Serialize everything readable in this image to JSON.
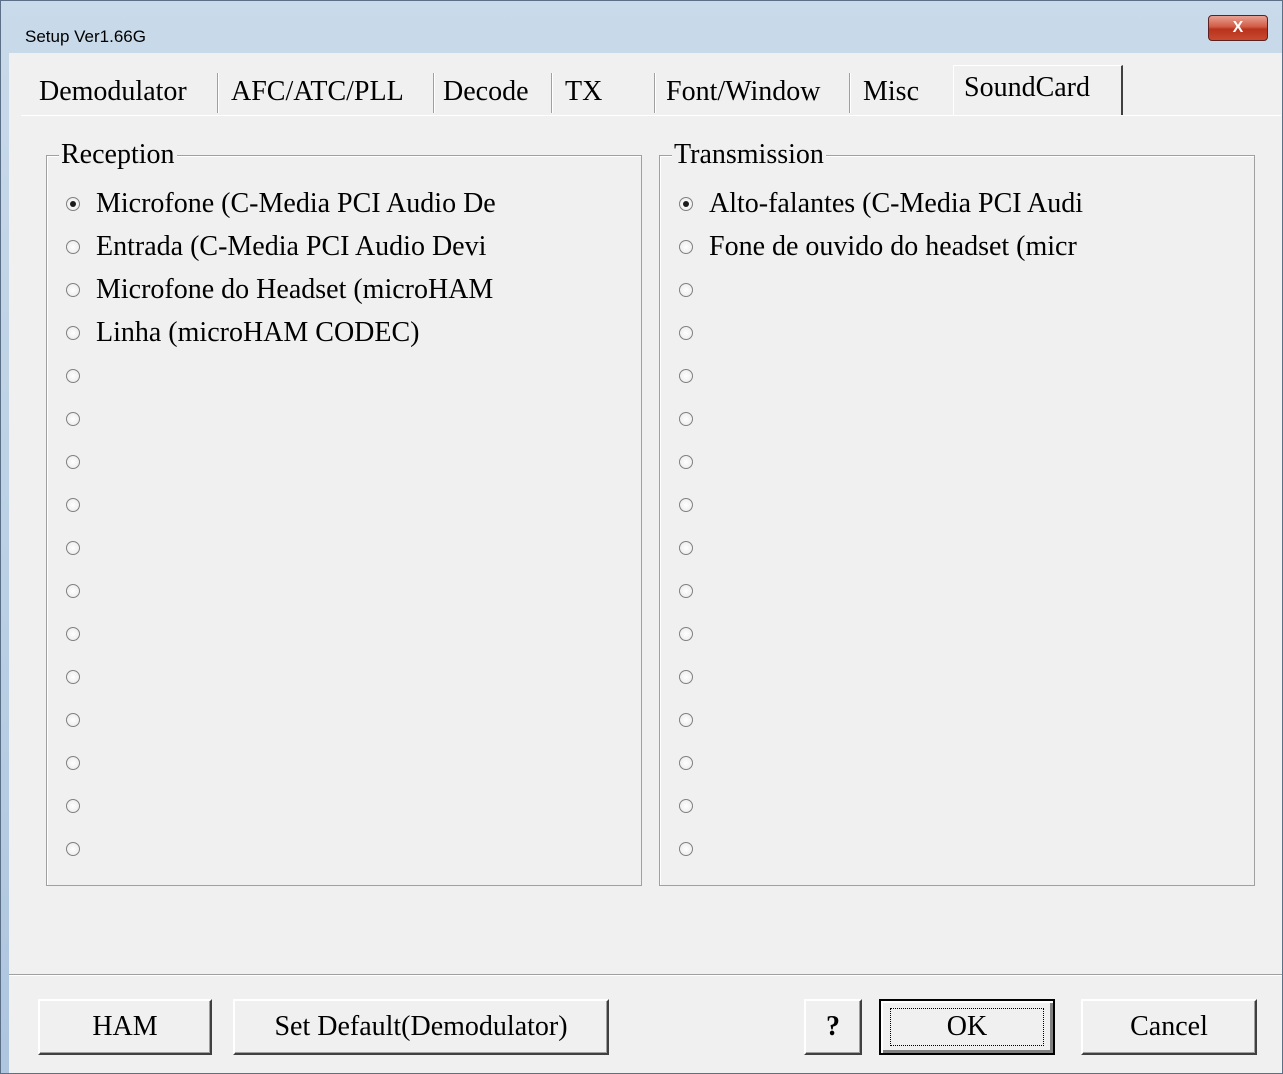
{
  "window": {
    "title": "Setup Ver1.66G",
    "close_label": "X"
  },
  "tabs": [
    {
      "label": "Demodulator",
      "active": false
    },
    {
      "label": "AFC/ATC/PLL",
      "active": false
    },
    {
      "label": "Decode",
      "active": false
    },
    {
      "label": "TX",
      "active": false
    },
    {
      "label": "Font/Window",
      "active": false
    },
    {
      "label": "Misc",
      "active": false
    },
    {
      "label": "SoundCard",
      "active": true
    }
  ],
  "reception": {
    "title": "Reception",
    "options": [
      {
        "label": "Microfone (C-Media PCI Audio De",
        "checked": true
      },
      {
        "label": "Entrada (C-Media PCI Audio Devi",
        "checked": false
      },
      {
        "label": "Microfone do Headset (microHAM",
        "checked": false
      },
      {
        "label": "Linha (microHAM CODEC)",
        "checked": false
      },
      {
        "label": "",
        "checked": false
      },
      {
        "label": "",
        "checked": false
      },
      {
        "label": "",
        "checked": false
      },
      {
        "label": "",
        "checked": false
      },
      {
        "label": "",
        "checked": false
      },
      {
        "label": "",
        "checked": false
      },
      {
        "label": "",
        "checked": false
      },
      {
        "label": "",
        "checked": false
      },
      {
        "label": "",
        "checked": false
      },
      {
        "label": "",
        "checked": false
      },
      {
        "label": "",
        "checked": false
      },
      {
        "label": "",
        "checked": false
      }
    ]
  },
  "transmission": {
    "title": "Transmission",
    "options": [
      {
        "label": "Alto-falantes (C-Media PCI Audi",
        "checked": true
      },
      {
        "label": "Fone de ouvido do headset (micr",
        "checked": false
      },
      {
        "label": "",
        "checked": false
      },
      {
        "label": "",
        "checked": false
      },
      {
        "label": "",
        "checked": false
      },
      {
        "label": "",
        "checked": false
      },
      {
        "label": "",
        "checked": false
      },
      {
        "label": "",
        "checked": false
      },
      {
        "label": "",
        "checked": false
      },
      {
        "label": "",
        "checked": false
      },
      {
        "label": "",
        "checked": false
      },
      {
        "label": "",
        "checked": false
      },
      {
        "label": "",
        "checked": false
      },
      {
        "label": "",
        "checked": false
      },
      {
        "label": "",
        "checked": false
      },
      {
        "label": "",
        "checked": false
      }
    ]
  },
  "buttons": {
    "ham": "HAM",
    "set_default": "Set Default(Demodulator)",
    "help": "?",
    "ok": "OK",
    "cancel": "Cancel"
  }
}
